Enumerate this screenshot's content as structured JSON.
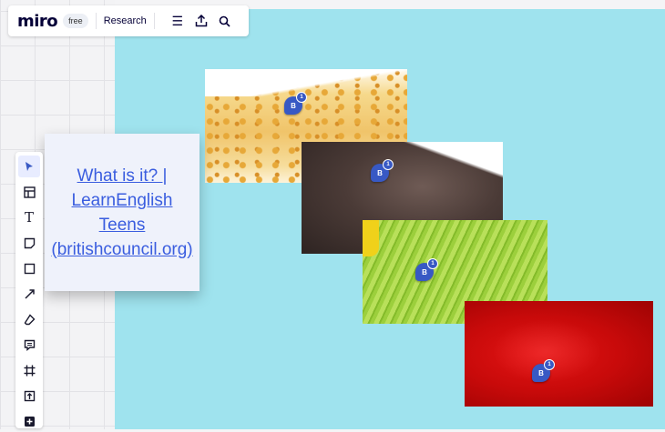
{
  "topbar": {
    "logo": "miro",
    "plan_badge": "free",
    "board_name": "Research",
    "menu_icon": "hamburger-menu-icon",
    "share_icon": "upload-icon",
    "search_icon": "search-icon"
  },
  "toolbar": {
    "tools": [
      {
        "name": "select-tool",
        "icon": "cursor-icon",
        "glyph": "➤"
      },
      {
        "name": "templates-tool",
        "icon": "template-icon",
        "glyph": "◫"
      },
      {
        "name": "text-tool",
        "icon": "text-icon",
        "glyph": "T"
      },
      {
        "name": "sticky-note-tool",
        "icon": "sticky-note-icon",
        "glyph": "▱"
      },
      {
        "name": "shape-tool",
        "icon": "square-icon",
        "glyph": "□"
      },
      {
        "name": "pen-tool",
        "icon": "arrow-line-icon",
        "glyph": "↗"
      },
      {
        "name": "eraser-tool",
        "icon": "eraser-icon",
        "glyph": "⌫"
      },
      {
        "name": "comment-tool",
        "icon": "comment-icon",
        "glyph": "☰"
      },
      {
        "name": "frame-tool",
        "icon": "frame-icon",
        "glyph": "#"
      },
      {
        "name": "upload-tool",
        "icon": "upload-icon",
        "glyph": "⇪"
      },
      {
        "name": "more-tool",
        "icon": "plus-icon",
        "glyph": "+"
      }
    ]
  },
  "note": {
    "link_text": "What is it? | LearnEnglish Teens (britishcouncil.org)"
  },
  "comments": [
    {
      "avatar": "B",
      "count": "1"
    },
    {
      "avatar": "B",
      "count": "1"
    },
    {
      "avatar": "B",
      "count": "1"
    },
    {
      "avatar": "B",
      "count": "1"
    }
  ],
  "colors": {
    "frame_bg": "#9fe3ee",
    "link": "#3a5ddf",
    "marker": "#3859c4"
  }
}
